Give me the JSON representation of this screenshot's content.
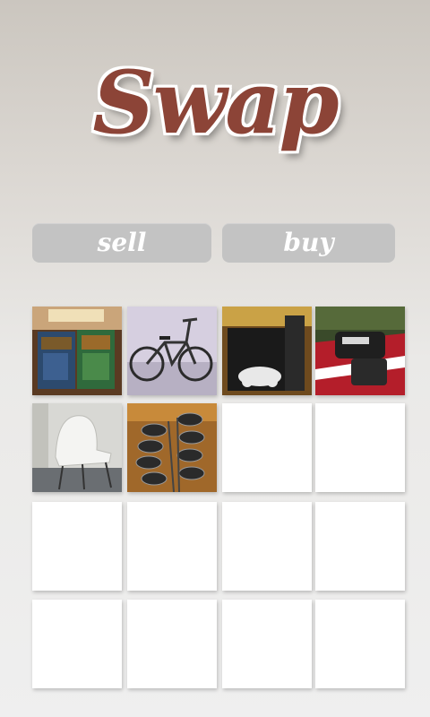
{
  "app": {
    "logo_text": "Swap"
  },
  "actions": {
    "sell_label": "sell",
    "buy_label": "buy"
  },
  "colors": {
    "brand": "#8c4437",
    "button_bg": "#c3c3c3",
    "button_text": "#ffffff",
    "tile_bg": "#ffffff"
  },
  "listings": [
    {
      "name": "harry-potter-books-photo"
    },
    {
      "name": "bicycle-photo"
    },
    {
      "name": "ps3-console-photo"
    },
    {
      "name": "snowboard-bindings-photo"
    },
    {
      "name": "white-chair-photo"
    },
    {
      "name": "golf-clubs-photo"
    }
  ],
  "empty_slots": 10
}
